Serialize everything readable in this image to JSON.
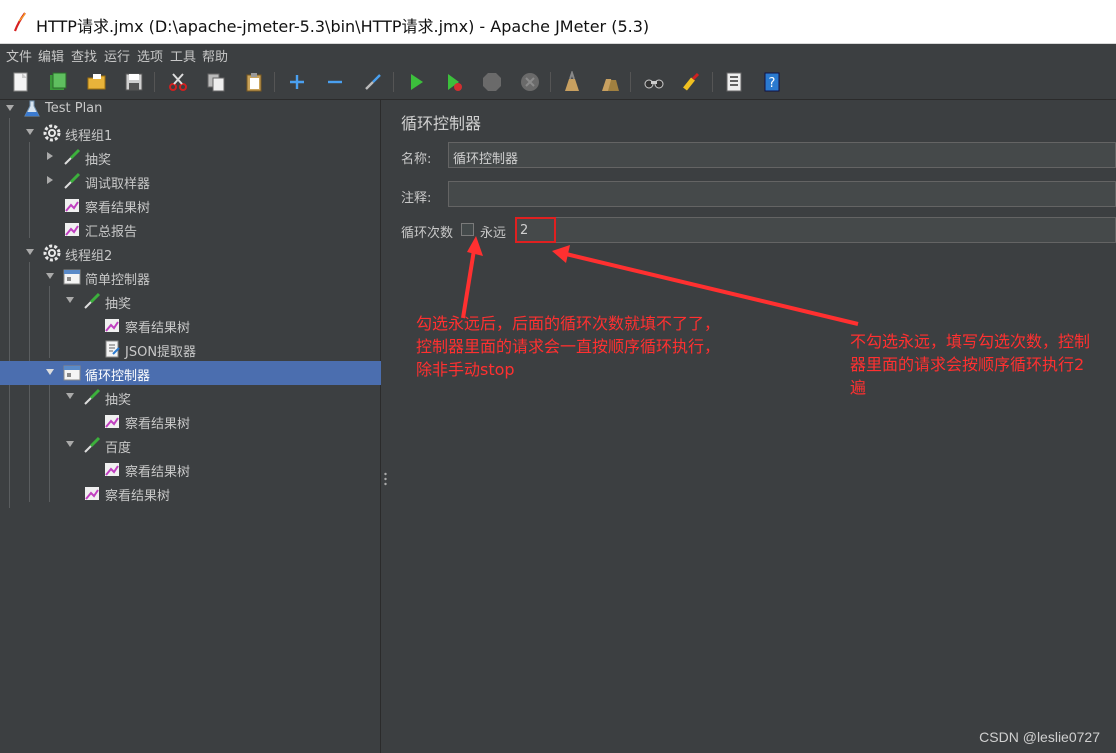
{
  "window": {
    "title": "HTTP请求.jmx (D:\\apache-jmeter-5.3\\bin\\HTTP请求.jmx) - Apache JMeter (5.3)"
  },
  "menu": [
    "文件",
    "编辑",
    "查找",
    "运行",
    "选项",
    "工具",
    "帮助"
  ],
  "toolbar": {
    "icons": [
      "new-icon",
      "templates-icon",
      "open-icon",
      "save-icon",
      "cut-icon",
      "copy-icon",
      "paste-icon",
      "expand-icon",
      "collapse-icon",
      "toggle-icon",
      "start-icon",
      "start-no-pause-icon",
      "stop-icon",
      "shutdown-icon",
      "clear-icon",
      "clear-all-icon",
      "search-icon",
      "reset-search-icon",
      "function-helper-icon",
      "help-icon"
    ]
  },
  "tree": {
    "nodes": [
      {
        "label": "Test Plan",
        "icon": "test-plan-icon",
        "expanded": true
      },
      {
        "label": "线程组1",
        "icon": "gear-icon",
        "expanded": true
      },
      {
        "label": "抽奖",
        "icon": "sampler-icon",
        "expanded": false
      },
      {
        "label": "调试取样器",
        "icon": "sampler-icon",
        "expanded": false
      },
      {
        "label": "察看结果树",
        "icon": "listener-icon"
      },
      {
        "label": "汇总报告",
        "icon": "listener-icon"
      },
      {
        "label": "线程组2",
        "icon": "gear-icon",
        "expanded": true
      },
      {
        "label": "简单控制器",
        "icon": "controller-icon",
        "expanded": true
      },
      {
        "label": "抽奖",
        "icon": "sampler-icon",
        "expanded": true
      },
      {
        "label": "察看结果树",
        "icon": "listener-icon"
      },
      {
        "label": "JSON提取器",
        "icon": "extractor-icon"
      },
      {
        "label": "循环控制器",
        "icon": "controller-icon",
        "expanded": true,
        "selected": true
      },
      {
        "label": "抽奖",
        "icon": "sampler-icon",
        "expanded": true
      },
      {
        "label": "察看结果树",
        "icon": "listener-icon"
      },
      {
        "label": "百度",
        "icon": "sampler-icon",
        "expanded": true
      },
      {
        "label": "察看结果树",
        "icon": "listener-icon"
      },
      {
        "label": "察看结果树",
        "icon": "listener-icon"
      }
    ]
  },
  "main": {
    "title": "循环控制器",
    "name_label": "名称:",
    "name_value": "循环控制器",
    "comment_label": "注释:",
    "comment_value": "",
    "loop_label": "循环次数",
    "forever_label": "永远",
    "forever_checked": false,
    "loop_count": "2"
  },
  "annotations": {
    "left": [
      "勾选永远后，后面的循环次数就填不了了，",
      "控制器里面的请求会一直按顺序循环执行，",
      "除非手动stop"
    ],
    "right": [
      "不勾选永远，填写勾选次数，控制",
      "器里面的请求会按顺序循环执行2",
      "遍"
    ]
  },
  "colors": {
    "selection": "#4b6eaf",
    "annotation": "#ff3030",
    "background": "#3c3f41"
  },
  "watermark": "CSDN @leslie0727"
}
